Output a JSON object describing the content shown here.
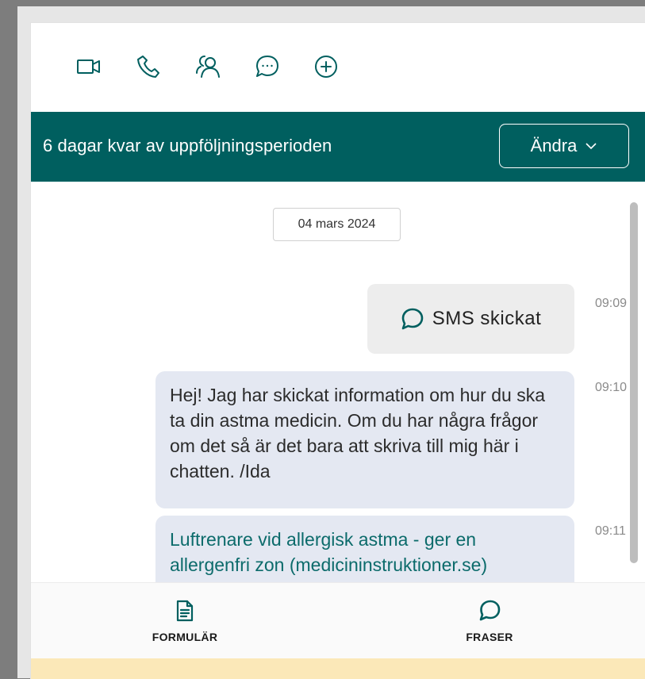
{
  "toolbar": {
    "icons": [
      "video-camera-icon",
      "phone-icon",
      "users-icon",
      "chat-bubble-icon",
      "add-circle-icon"
    ]
  },
  "banner": {
    "text": "6 dagar kvar av uppföljningsperioden",
    "change_label": "Ändra",
    "change_icon": "chevron-down-icon",
    "background": "#005f5f"
  },
  "chat": {
    "date": "04 mars 2024",
    "messages": [
      {
        "type": "sms",
        "icon": "chat-bubble-icon",
        "text": "SMS skickat",
        "time": "09:09"
      },
      {
        "type": "text",
        "text": "Hej! Jag har skickat information om hur du ska ta din astma medicin. Om du har några frågor om det så är det bara att skriva till mig här i chatten. /Ida",
        "time": "09:10"
      },
      {
        "type": "link",
        "text": "Luftrenare vid allergisk astma - ger en allergenfri zon (medicininstruktioner.se)",
        "time": "09:11"
      }
    ]
  },
  "bottom_nav": {
    "items": [
      {
        "label": "FORMULÄR",
        "icon": "document-icon"
      },
      {
        "label": "FRASER",
        "icon": "chat-bubble-icon"
      }
    ]
  },
  "colors": {
    "accent": "#005f5f",
    "bubble": "#e4e8f2",
    "sms_bubble": "#ededed",
    "link": "#0c6b6b",
    "footer_strip": "#fbe8b8"
  }
}
